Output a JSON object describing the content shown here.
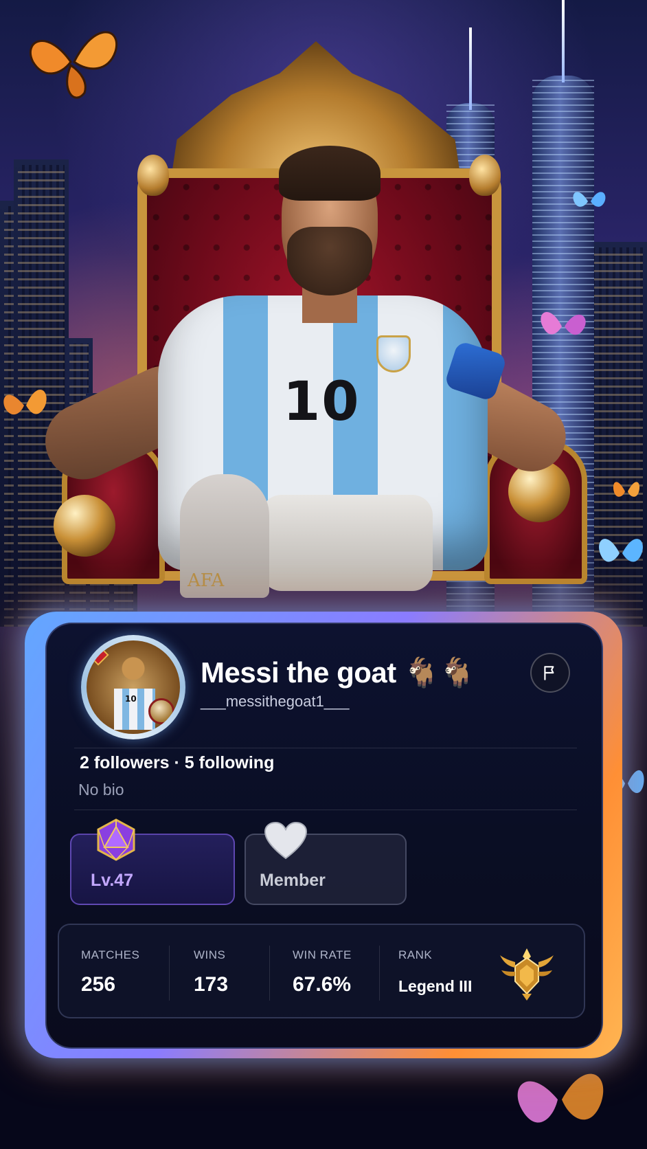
{
  "profile": {
    "display_name": "Messi the goat 🐐🐐",
    "handle": "___messithegoat1___",
    "follow_summary": "2 followers · 5 following",
    "bio": "No bio",
    "flag_icon": "flag-icon"
  },
  "badges": {
    "level": {
      "label": "Lv.47",
      "icon": "d20-gem-icon"
    },
    "membership": {
      "label": "Member",
      "icon": "heart-icon"
    }
  },
  "stats": {
    "matches": {
      "label": "MATCHES",
      "value": "256"
    },
    "wins": {
      "label": "WINS",
      "value": "173"
    },
    "win_rate": {
      "label": "WIN RATE",
      "value": "67.6%"
    },
    "rank": {
      "label": "RANK",
      "value": "Legend III",
      "icon": "rank-crest-icon"
    }
  },
  "colors": {
    "card_bg": "#0a0e24",
    "glow_blue": "#63a7ff",
    "glow_orange": "#ff8f35",
    "level_purple": "#c3a8ff"
  }
}
